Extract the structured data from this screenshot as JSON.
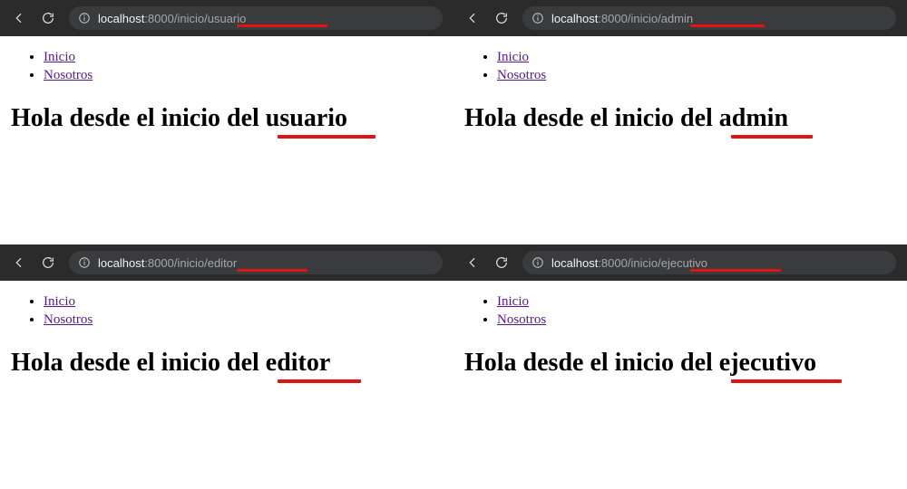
{
  "panels": [
    {
      "url": {
        "host": "localhost",
        "port": ":8000",
        "path_a": "/inicio/",
        "path_b": "usuario"
      },
      "nav": {
        "inicio": "Inicio",
        "nosotros": "Nosotros"
      },
      "headline_prefix": "Hola desde el inicio del ",
      "headline_word": "usuario"
    },
    {
      "url": {
        "host": "localhost",
        "port": ":8000",
        "path_a": "/inicio/",
        "path_b": "admin"
      },
      "nav": {
        "inicio": "Inicio",
        "nosotros": "Nosotros"
      },
      "headline_prefix": "Hola desde el inicio del ",
      "headline_word": "admin"
    },
    {
      "url": {
        "host": "localhost",
        "port": ":8000",
        "path_a": "/inicio/",
        "path_b": "editor"
      },
      "nav": {
        "inicio": "Inicio",
        "nosotros": "Nosotros"
      },
      "headline_prefix": "Hola desde el inicio del ",
      "headline_word": "editor"
    },
    {
      "url": {
        "host": "localhost",
        "port": ":8000",
        "path_a": "/inicio/",
        "path_b": "ejecutivo"
      },
      "nav": {
        "inicio": "Inicio",
        "nosotros": "Nosotros"
      },
      "headline_prefix": "Hola desde el inicio del ",
      "headline_word": "ejecutivo"
    }
  ]
}
